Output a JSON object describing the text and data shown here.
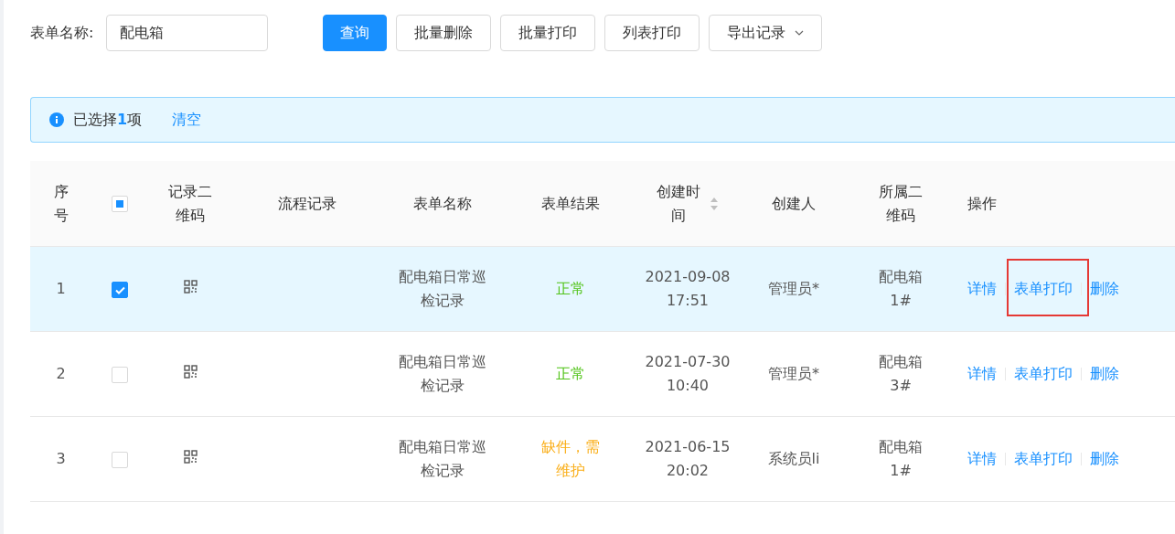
{
  "filter": {
    "label": "表单名称:",
    "value": "配电箱"
  },
  "buttons": [
    {
      "label": "查询",
      "kind": "primary"
    },
    {
      "label": "批量删除",
      "kind": "default"
    },
    {
      "label": "批量打印",
      "kind": "default"
    },
    {
      "label": "列表打印",
      "kind": "default"
    },
    {
      "label": "导出记录",
      "kind": "dropdown"
    }
  ],
  "selection_alert": {
    "message": "已选择**1**项",
    "action": "清空"
  },
  "table": {
    "columns": [
      {
        "label": "序号",
        "kind": "text"
      },
      {
        "kind": "checkbox",
        "indeterminate": true
      },
      {
        "label": "记录二维码",
        "kind": "text"
      },
      {
        "label": "流程记录",
        "kind": "text"
      },
      {
        "label": "表单名称",
        "kind": "text"
      },
      {
        "label": "表单结果",
        "kind": "text"
      },
      {
        "label": "创建时间",
        "kind": "sortable"
      },
      {
        "label": "创建人",
        "kind": "text"
      },
      {
        "label": "所属二维码",
        "kind": "text"
      },
      {
        "label": "操作",
        "kind": "text"
      }
    ],
    "rows": [
      {
        "index": "1",
        "selected": true,
        "form_name": "配电箱日常巡检记录",
        "result": {
          "text": "正常",
          "color": "#52c41a"
        },
        "created": "2021-09-08 17:51",
        "creator": "管理员*",
        "qr_owner": "配电箱1#",
        "actions": [
          {
            "label": "详情",
            "boxed": false
          },
          {
            "label": "表单打印",
            "boxed": true
          },
          {
            "label": "删除",
            "boxed": false
          }
        ]
      },
      {
        "index": "2",
        "selected": false,
        "form_name": "配电箱日常巡检记录",
        "result": {
          "text": "正常",
          "color": "#52c41a"
        },
        "created": "2021-07-30 10:40",
        "creator": "管理员*",
        "qr_owner": "配电箱3#",
        "actions": [
          {
            "label": "详情",
            "boxed": false
          },
          {
            "label": "表单打印",
            "boxed": false
          },
          {
            "label": "删除",
            "boxed": false
          }
        ]
      },
      {
        "index": "3",
        "selected": false,
        "form_name": "配电箱日常巡检记录",
        "result": {
          "text": "缺件，需维护",
          "color": "#faad14"
        },
        "created": "2021-06-15 20:02",
        "creator": "系统员li",
        "qr_owner": "配电箱1#",
        "actions": [
          {
            "label": "详情",
            "boxed": false
          },
          {
            "label": "表单打印",
            "boxed": false
          },
          {
            "label": "删除",
            "boxed": false
          }
        ]
      }
    ]
  }
}
